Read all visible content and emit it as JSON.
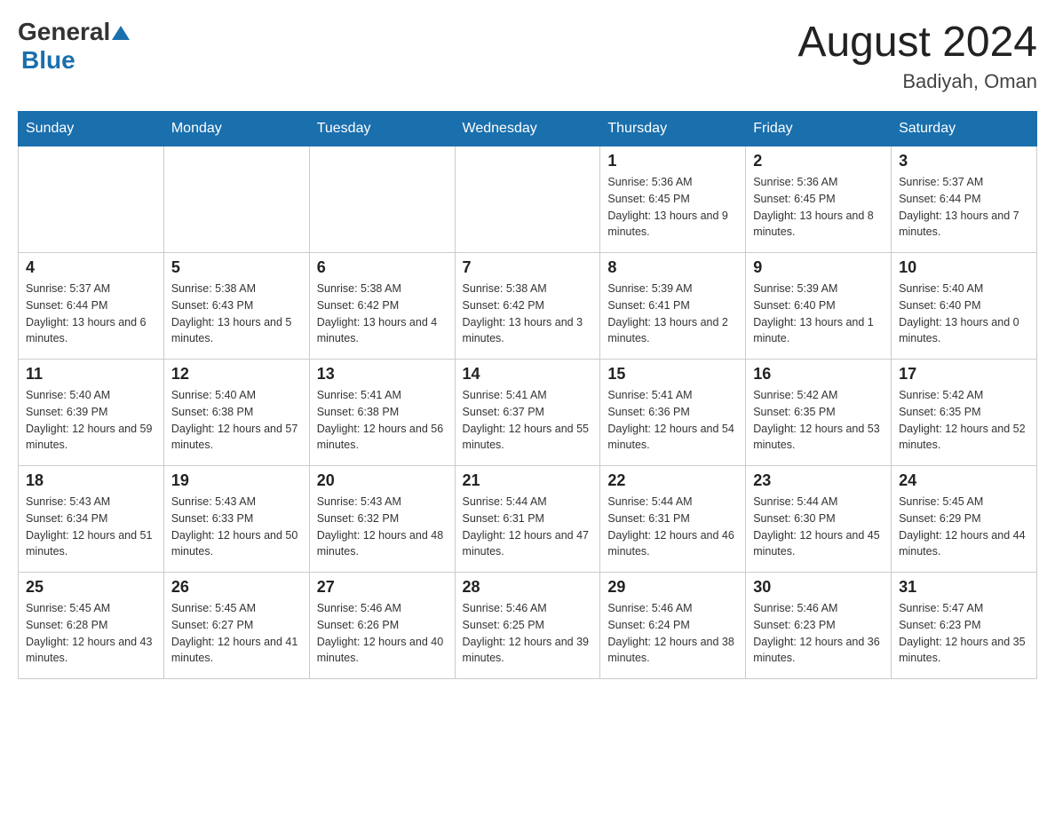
{
  "header": {
    "logo_general": "General",
    "logo_blue": "Blue",
    "month_title": "August 2024",
    "location": "Badiyah, Oman"
  },
  "days_of_week": [
    "Sunday",
    "Monday",
    "Tuesday",
    "Wednesday",
    "Thursday",
    "Friday",
    "Saturday"
  ],
  "weeks": [
    [
      {
        "day": "",
        "info": ""
      },
      {
        "day": "",
        "info": ""
      },
      {
        "day": "",
        "info": ""
      },
      {
        "day": "",
        "info": ""
      },
      {
        "day": "1",
        "info": "Sunrise: 5:36 AM\nSunset: 6:45 PM\nDaylight: 13 hours and 9 minutes."
      },
      {
        "day": "2",
        "info": "Sunrise: 5:36 AM\nSunset: 6:45 PM\nDaylight: 13 hours and 8 minutes."
      },
      {
        "day": "3",
        "info": "Sunrise: 5:37 AM\nSunset: 6:44 PM\nDaylight: 13 hours and 7 minutes."
      }
    ],
    [
      {
        "day": "4",
        "info": "Sunrise: 5:37 AM\nSunset: 6:44 PM\nDaylight: 13 hours and 6 minutes."
      },
      {
        "day": "5",
        "info": "Sunrise: 5:38 AM\nSunset: 6:43 PM\nDaylight: 13 hours and 5 minutes."
      },
      {
        "day": "6",
        "info": "Sunrise: 5:38 AM\nSunset: 6:42 PM\nDaylight: 13 hours and 4 minutes."
      },
      {
        "day": "7",
        "info": "Sunrise: 5:38 AM\nSunset: 6:42 PM\nDaylight: 13 hours and 3 minutes."
      },
      {
        "day": "8",
        "info": "Sunrise: 5:39 AM\nSunset: 6:41 PM\nDaylight: 13 hours and 2 minutes."
      },
      {
        "day": "9",
        "info": "Sunrise: 5:39 AM\nSunset: 6:40 PM\nDaylight: 13 hours and 1 minute."
      },
      {
        "day": "10",
        "info": "Sunrise: 5:40 AM\nSunset: 6:40 PM\nDaylight: 13 hours and 0 minutes."
      }
    ],
    [
      {
        "day": "11",
        "info": "Sunrise: 5:40 AM\nSunset: 6:39 PM\nDaylight: 12 hours and 59 minutes."
      },
      {
        "day": "12",
        "info": "Sunrise: 5:40 AM\nSunset: 6:38 PM\nDaylight: 12 hours and 57 minutes."
      },
      {
        "day": "13",
        "info": "Sunrise: 5:41 AM\nSunset: 6:38 PM\nDaylight: 12 hours and 56 minutes."
      },
      {
        "day": "14",
        "info": "Sunrise: 5:41 AM\nSunset: 6:37 PM\nDaylight: 12 hours and 55 minutes."
      },
      {
        "day": "15",
        "info": "Sunrise: 5:41 AM\nSunset: 6:36 PM\nDaylight: 12 hours and 54 minutes."
      },
      {
        "day": "16",
        "info": "Sunrise: 5:42 AM\nSunset: 6:35 PM\nDaylight: 12 hours and 53 minutes."
      },
      {
        "day": "17",
        "info": "Sunrise: 5:42 AM\nSunset: 6:35 PM\nDaylight: 12 hours and 52 minutes."
      }
    ],
    [
      {
        "day": "18",
        "info": "Sunrise: 5:43 AM\nSunset: 6:34 PM\nDaylight: 12 hours and 51 minutes."
      },
      {
        "day": "19",
        "info": "Sunrise: 5:43 AM\nSunset: 6:33 PM\nDaylight: 12 hours and 50 minutes."
      },
      {
        "day": "20",
        "info": "Sunrise: 5:43 AM\nSunset: 6:32 PM\nDaylight: 12 hours and 48 minutes."
      },
      {
        "day": "21",
        "info": "Sunrise: 5:44 AM\nSunset: 6:31 PM\nDaylight: 12 hours and 47 minutes."
      },
      {
        "day": "22",
        "info": "Sunrise: 5:44 AM\nSunset: 6:31 PM\nDaylight: 12 hours and 46 minutes."
      },
      {
        "day": "23",
        "info": "Sunrise: 5:44 AM\nSunset: 6:30 PM\nDaylight: 12 hours and 45 minutes."
      },
      {
        "day": "24",
        "info": "Sunrise: 5:45 AM\nSunset: 6:29 PM\nDaylight: 12 hours and 44 minutes."
      }
    ],
    [
      {
        "day": "25",
        "info": "Sunrise: 5:45 AM\nSunset: 6:28 PM\nDaylight: 12 hours and 43 minutes."
      },
      {
        "day": "26",
        "info": "Sunrise: 5:45 AM\nSunset: 6:27 PM\nDaylight: 12 hours and 41 minutes."
      },
      {
        "day": "27",
        "info": "Sunrise: 5:46 AM\nSunset: 6:26 PM\nDaylight: 12 hours and 40 minutes."
      },
      {
        "day": "28",
        "info": "Sunrise: 5:46 AM\nSunset: 6:25 PM\nDaylight: 12 hours and 39 minutes."
      },
      {
        "day": "29",
        "info": "Sunrise: 5:46 AM\nSunset: 6:24 PM\nDaylight: 12 hours and 38 minutes."
      },
      {
        "day": "30",
        "info": "Sunrise: 5:46 AM\nSunset: 6:23 PM\nDaylight: 12 hours and 36 minutes."
      },
      {
        "day": "31",
        "info": "Sunrise: 5:47 AM\nSunset: 6:23 PM\nDaylight: 12 hours and 35 minutes."
      }
    ]
  ]
}
